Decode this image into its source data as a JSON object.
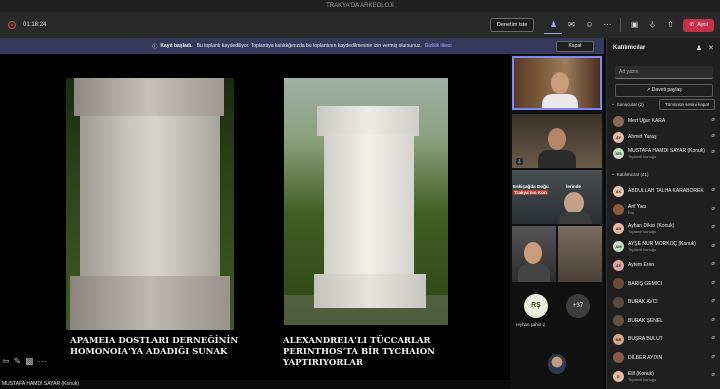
{
  "window": {
    "title": "TRAKYA'DA ARKEOLOJİ"
  },
  "toolbar": {
    "timer": "01:18:24",
    "record_label": "Denetim iste",
    "leave_label": "Ayrıl"
  },
  "banner": {
    "strong": "Kayıt başladı.",
    "text": "Bu toplantı kaydediliyor. Toplantıya katıldığınızda bu toplantının kaydedilmesine izin vermiş olursunuz.",
    "link": "Gizlilik ilkesi",
    "close_label": "Kapat"
  },
  "slide": {
    "caption_left": "APAMEIA DOSTLARI DERNEĞİNİN HOMONOIA‘YA ADADIĞI SUNAK",
    "caption_right": "ALEXANDREIA‘LI TÜCCARLAR PERINTHOS‘TA BİR TYCHAION YAPTIRIYORLAR"
  },
  "presenter_label": "MUSTAFA HAMDİ SAYAR (Konuk)",
  "tiles": {
    "tile3_line1": "Eskiçağda Doğu",
    "tile3_line2": "Trakya'nın Kon",
    "tile3_line1b": "lerinde",
    "avatar_initials": "RŞ",
    "more_count": "+37",
    "avatar_name": "reyhan şahin"
  },
  "panel": {
    "title": "Katılımcılar",
    "search_placeholder": "Ad yazın",
    "share_label": "Daveti paylaş",
    "presenters_label": "Sunucular (2)",
    "mute_all_label": "Tümünün sesini kapat",
    "attendees_label": "Katılımcılar (41)",
    "presenters": [
      {
        "name": "Mert Uğur KARA",
        "sub": "",
        "color": "#8a6a55",
        "initials": ""
      },
      {
        "name": "Ahmet Yaraş",
        "sub": "",
        "color": "#e6b8a0",
        "initials": "AY"
      },
      {
        "name": "MUSTAFA HAMDİ SAYAR (Konuk)",
        "sub": "Toplantı konuğu",
        "color": "#c8dcc0",
        "initials": "MS"
      }
    ],
    "attendees": [
      {
        "name": "ABDULLAH TALHA KARABÖREK",
        "sub": "",
        "color": "#ecc6a6",
        "initials": "AK"
      },
      {
        "name": "Arif Yacı",
        "sub": "Dış",
        "color": "#8b5a3a",
        "initials": ""
      },
      {
        "name": "Ayhan Dikici (Konuk)",
        "sub": "Toplantı konuğu",
        "color": "#e6b8a0",
        "initials": "AD"
      },
      {
        "name": "AYŞE NUR MORKOÇ (Konuk)",
        "sub": "Toplantı konuğu",
        "color": "#c8dcc0",
        "initials": "AM"
      },
      {
        "name": "Aytem Eren",
        "sub": "",
        "color": "#e0a0a8",
        "initials": "AE"
      },
      {
        "name": "BARIŞ GEMİCİ",
        "sub": "",
        "color": "#6b4a3a",
        "initials": ""
      },
      {
        "name": "BURAK AVCI",
        "sub": "",
        "color": "#5a4a42",
        "initials": ""
      },
      {
        "name": "BURAK ŞENEL",
        "sub": "",
        "color": "#6a5040",
        "initials": ""
      },
      {
        "name": "BÜŞRA BULUT",
        "sub": "",
        "color": "#d7a58a",
        "initials": "BB"
      },
      {
        "name": "DİLBER AYDIN",
        "sub": "",
        "color": "#8a5a48",
        "initials": ""
      },
      {
        "name": "Elif (Konuk)",
        "sub": "Toplantı konuğu",
        "color": "#e6b8a0",
        "initials": "E"
      }
    ]
  }
}
